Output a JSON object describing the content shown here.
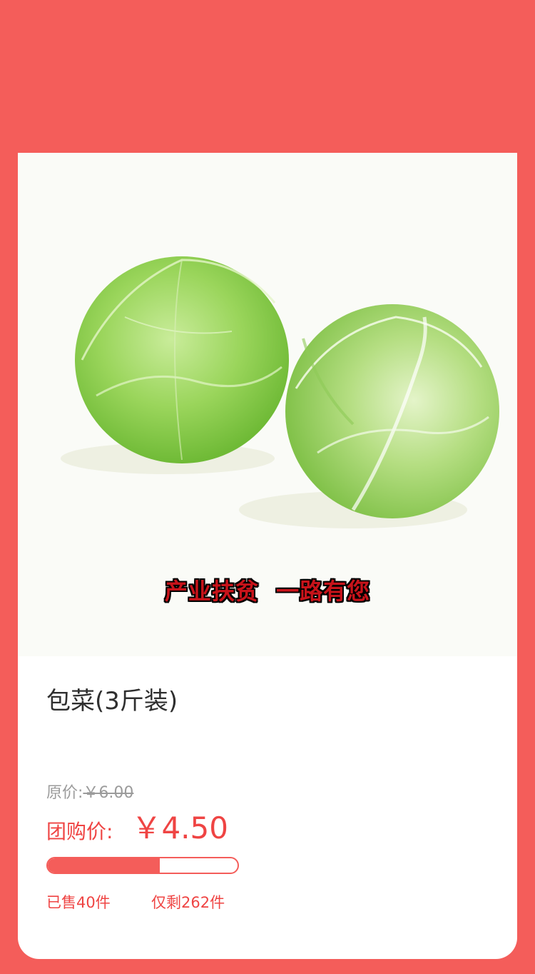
{
  "product": {
    "name": "包菜(3斤装)",
    "image_slogan": "产业扶贫  一路有您",
    "original_price_label": "原价:",
    "original_price": "￥6.00",
    "group_price_label": "团购价:",
    "group_price": "￥4.50",
    "sold_text": "已售40件",
    "remaining_text": "仅剩262件",
    "sold_progress": 0.59
  },
  "colors": {
    "background": "#f45d5a",
    "accent": "#ef4443"
  },
  "icons": {
    "image": "cabbage-photo"
  }
}
